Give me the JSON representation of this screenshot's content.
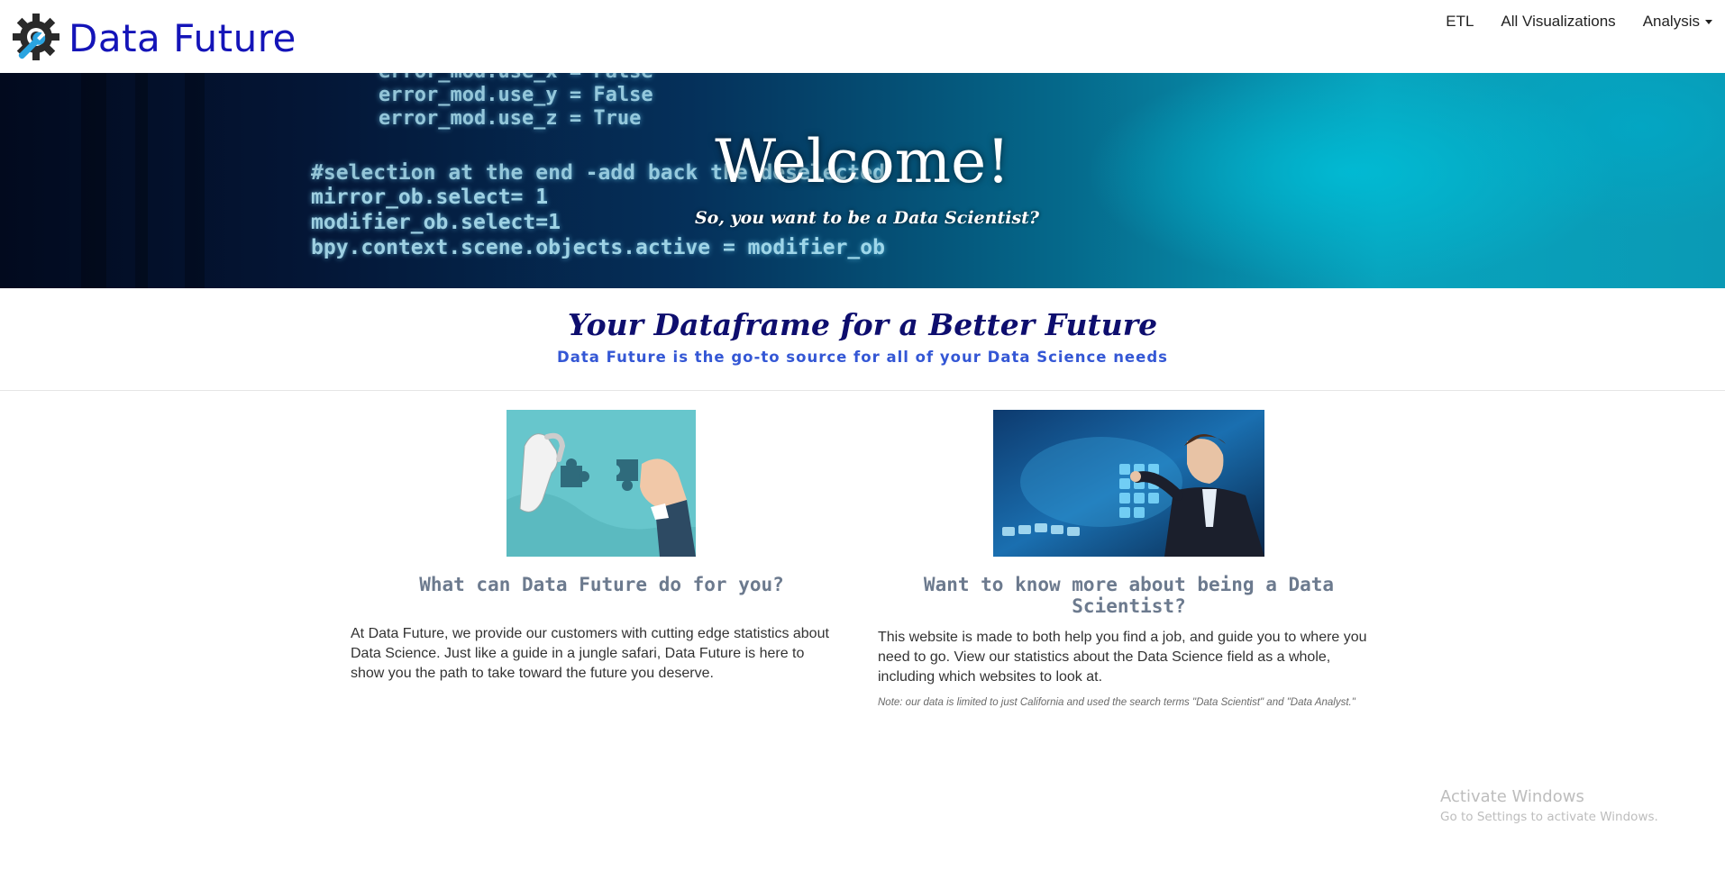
{
  "navbar": {
    "brand": "Data Future",
    "links": [
      {
        "label": "ETL"
      },
      {
        "label": "All Visualizations"
      },
      {
        "label": "Analysis"
      }
    ]
  },
  "hero": {
    "title": "Welcome!",
    "subtitle": "So, you want to be a Data Scientist?",
    "code_lines": [
      "error_mod.use_x = False",
      "error_mod.use_y = False",
      "error_mod.use_z = True",
      "#selection at the end -add back the deselected",
      "mirror_ob.select= 1",
      "modifier_ob.select=1",
      "bpy.context.scene.objects.active = modifier_ob"
    ]
  },
  "tagline": {
    "title": "Your Dataframe for a Better Future",
    "subtitle": "Data Future is the go-to source for all of your Data Science needs"
  },
  "cards": [
    {
      "title": "What can Data Future do for you?",
      "text": "At Data Future, we provide our customers with cutting edge statistics about Data Science. Just like a guide in a jungle safari, Data Future is here to show you the path to take toward the future you deserve."
    },
    {
      "title": "Want to know more about being a Data Scientist?",
      "text": "This website is made to both help you find a job, and guide you to where you need to go. View our statistics about the Data Science field as a whole, including which websites to look at.",
      "note": "Note: our data is limited to just California and used the search terms \"Data Scientist\" and \"Data Analyst.\""
    }
  ],
  "watermark": {
    "title": "Activate Windows",
    "subtitle": "Go to Settings to activate Windows."
  },
  "colors": {
    "brand": "#1414b8",
    "tagline_title": "#0e0e6e",
    "tagline_sub": "#3457d5",
    "card_title": "#6c7a8e"
  },
  "icons": {
    "brand_logo": "gear-wrench-icon"
  }
}
